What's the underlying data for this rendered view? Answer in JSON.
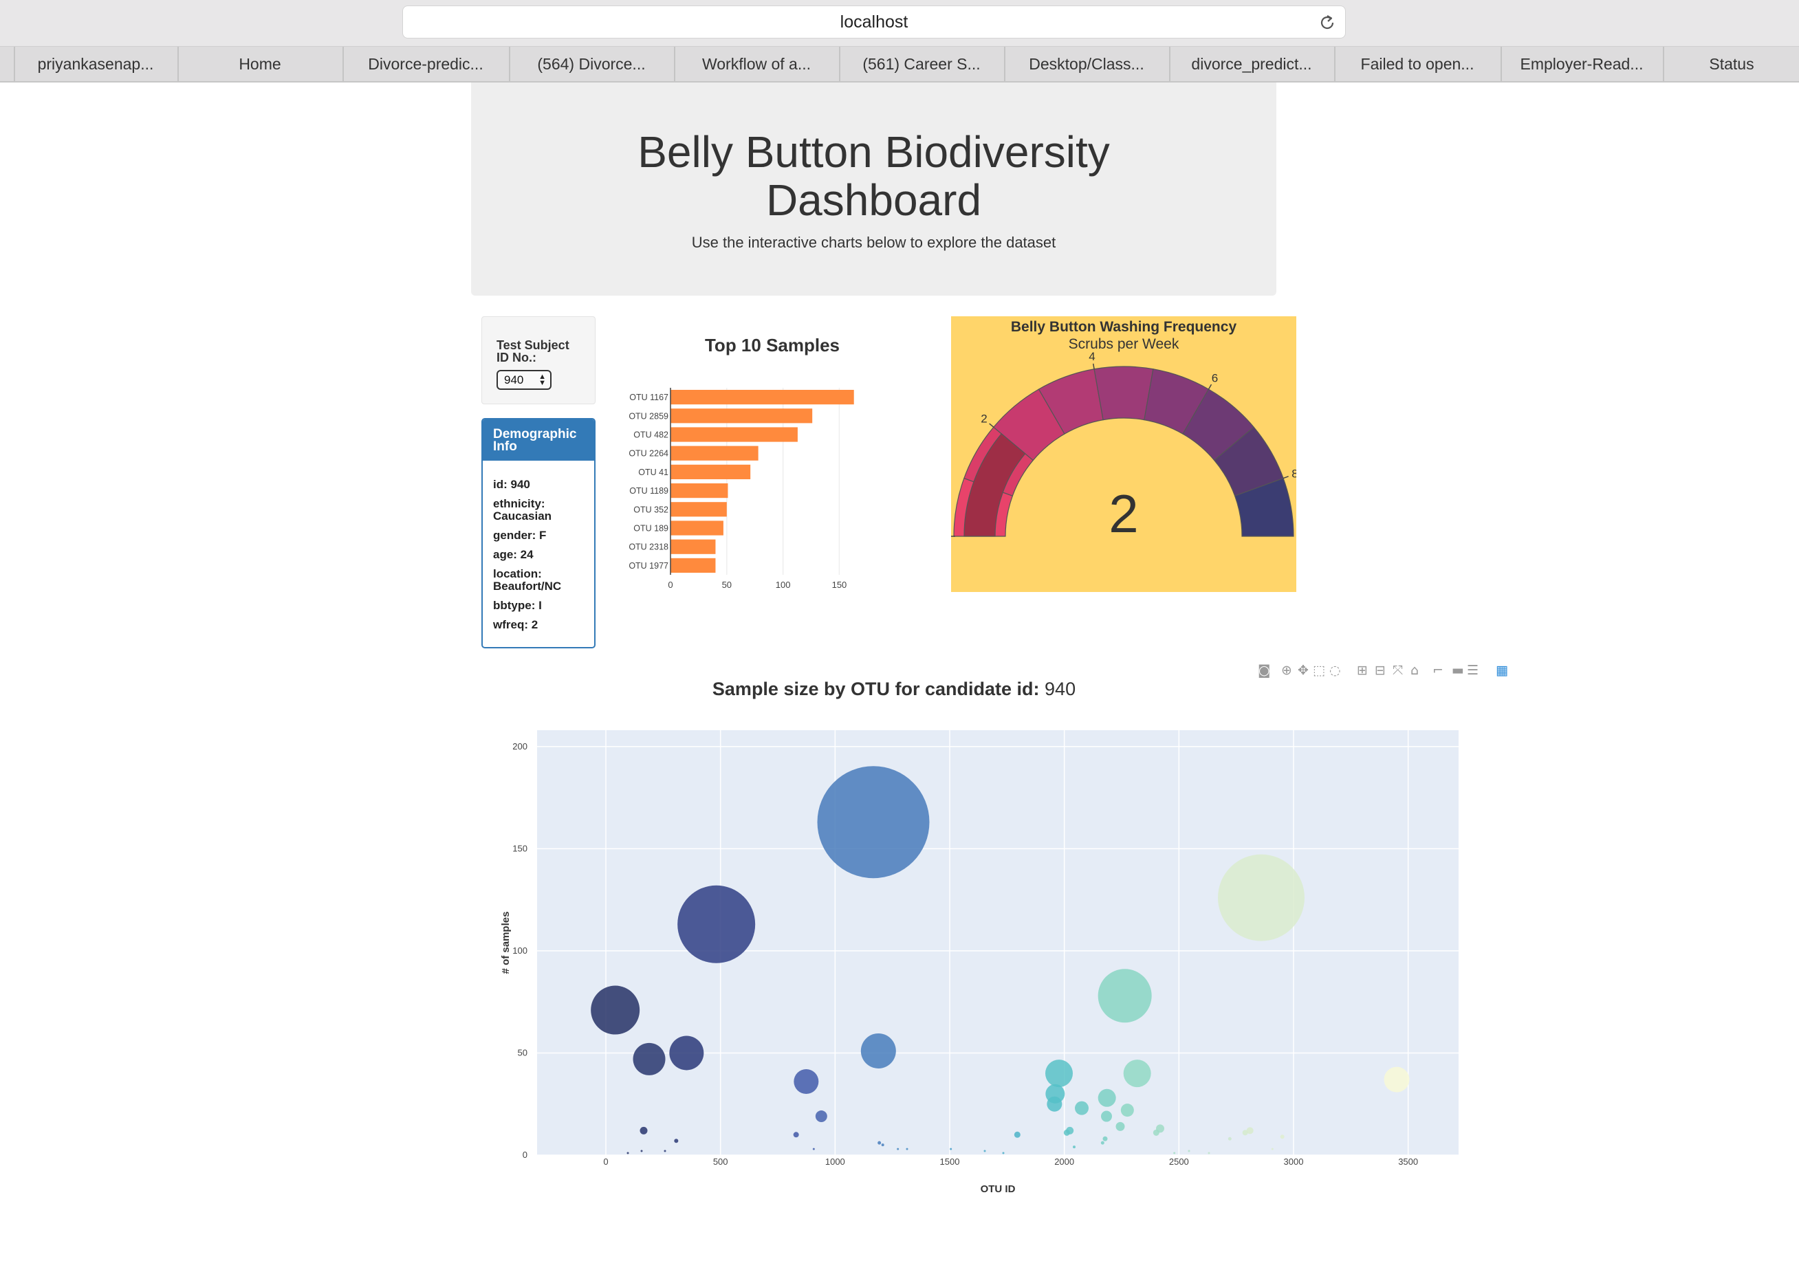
{
  "browser": {
    "url": "localhost",
    "bookmarks": [
      "priyankasenap...",
      "Home",
      "Divorce-predic...",
      "(564) Divorce...",
      "Workflow of a...",
      "(561) Career S...",
      "Desktop/Class...",
      "divorce_predict...",
      "Failed to open...",
      "Employer-Read...",
      "Status"
    ]
  },
  "header": {
    "title_line1": "Belly Button Biodiversity",
    "title_line2": "Dashboard",
    "subtitle": "Use the interactive charts below to explore the dataset"
  },
  "selector": {
    "label_line1": "Test Subject",
    "label_line2": "ID No.:",
    "value": "940"
  },
  "demographics": {
    "heading_line1": "Demographic",
    "heading_line2": "Info",
    "lines": [
      "id: 940",
      "ethnicity:",
      "Caucasian",
      "gender: F",
      "age: 24",
      "location:",
      "Beaufort/NC",
      "bbtype: I",
      "wfreq: 2"
    ]
  },
  "colors": {
    "bar": "#ff8a3d",
    "gauge_background": "#ffd56a",
    "panel_primary": "#337ab7",
    "plot_background": "#e5ecf6"
  },
  "chart_data": [
    {
      "type": "bar",
      "orientation": "horizontal",
      "title": "Top 10 Samples",
      "categories": [
        "OTU 1167",
        "OTU 2859",
        "OTU 482",
        "OTU 2264",
        "OTU 41",
        "OTU 1189",
        "OTU 352",
        "OTU 189",
        "OTU 2318",
        "OTU 1977"
      ],
      "values": [
        163,
        126,
        113,
        78,
        71,
        51,
        50,
        47,
        40,
        40
      ],
      "xlim": [
        0,
        165
      ],
      "xticks": [
        0,
        50,
        100,
        150
      ],
      "color": "#ff8a3d"
    },
    {
      "type": "gauge",
      "title": "Belly Button Washing Frequency",
      "subtitle": "Scrubs per Week",
      "value": 2,
      "range": [
        0,
        9
      ],
      "tick_labels": [
        "2",
        "4",
        "6",
        "8"
      ],
      "tick_values": [
        2,
        4,
        6,
        8
      ],
      "steps": [
        {
          "range": [
            0,
            1
          ],
          "color": "#e8436a"
        },
        {
          "range": [
            1,
            2
          ],
          "color": "#da3d68"
        },
        {
          "range": [
            2,
            3
          ],
          "color": "#c83a6e"
        },
        {
          "range": [
            3,
            4
          ],
          "color": "#b23b74"
        },
        {
          "range": [
            4,
            5
          ],
          "color": "#9c3b77"
        },
        {
          "range": [
            5,
            6
          ],
          "color": "#843a77"
        },
        {
          "range": [
            6,
            7
          ],
          "color": "#6d3a74"
        },
        {
          "range": [
            7,
            8
          ],
          "color": "#573a6e"
        },
        {
          "range": [
            8,
            9
          ],
          "color": "#3b3d72"
        }
      ],
      "bar_color": "#9e2e46"
    },
    {
      "type": "scatter",
      "subtype": "bubble",
      "title_bold": "Sample size by OTU for candidate id:",
      "title_value": "940",
      "xlabel": "OTU ID",
      "ylabel": "# of samples",
      "xlim": [
        -300,
        3720
      ],
      "ylim": [
        0,
        208
      ],
      "xticks": [
        0,
        500,
        1000,
        1500,
        2000,
        2500,
        3000,
        3500
      ],
      "yticks": [
        0,
        50,
        100,
        150,
        200
      ],
      "grid": true,
      "points": [
        {
          "x": 1167,
          "y": 163,
          "size": 163
        },
        {
          "x": 2859,
          "y": 126,
          "size": 126
        },
        {
          "x": 482,
          "y": 113,
          "size": 113
        },
        {
          "x": 2264,
          "y": 78,
          "size": 78
        },
        {
          "x": 41,
          "y": 71,
          "size": 71
        },
        {
          "x": 1189,
          "y": 51,
          "size": 51
        },
        {
          "x": 352,
          "y": 50,
          "size": 50
        },
        {
          "x": 189,
          "y": 47,
          "size": 47
        },
        {
          "x": 2318,
          "y": 40,
          "size": 40
        },
        {
          "x": 1977,
          "y": 40,
          "size": 40
        },
        {
          "x": 3450,
          "y": 37,
          "size": 37
        },
        {
          "x": 874,
          "y": 36,
          "size": 36
        },
        {
          "x": 1960,
          "y": 30,
          "size": 28
        },
        {
          "x": 2186,
          "y": 28,
          "size": 26
        },
        {
          "x": 1957,
          "y": 25,
          "size": 22
        },
        {
          "x": 2076,
          "y": 23,
          "size": 20
        },
        {
          "x": 2275,
          "y": 22,
          "size": 19
        },
        {
          "x": 940,
          "y": 19,
          "size": 17
        },
        {
          "x": 2184,
          "y": 19,
          "size": 16
        },
        {
          "x": 2244,
          "y": 14,
          "size": 13
        },
        {
          "x": 2418,
          "y": 13,
          "size": 12
        },
        {
          "x": 2024,
          "y": 12,
          "size": 11
        },
        {
          "x": 165,
          "y": 12,
          "size": 11
        },
        {
          "x": 2810,
          "y": 12,
          "size": 10
        },
        {
          "x": 2401,
          "y": 11,
          "size": 9
        },
        {
          "x": 2011,
          "y": 11,
          "size": 9
        },
        {
          "x": 1795,
          "y": 10,
          "size": 9
        },
        {
          "x": 2789,
          "y": 11,
          "size": 8
        },
        {
          "x": 830,
          "y": 10,
          "size": 8
        },
        {
          "x": 2178,
          "y": 8,
          "size": 7
        },
        {
          "x": 2951,
          "y": 9,
          "size": 6
        },
        {
          "x": 307,
          "y": 7,
          "size": 6
        },
        {
          "x": 2722,
          "y": 8,
          "size": 5
        },
        {
          "x": 1193,
          "y": 6,
          "size": 5
        },
        {
          "x": 2167,
          "y": 6,
          "size": 5
        },
        {
          "x": 1208,
          "y": 5,
          "size": 4
        },
        {
          "x": 2043,
          "y": 4,
          "size": 4
        },
        {
          "x": 1274,
          "y": 3,
          "size": 3
        },
        {
          "x": 1314,
          "y": 3,
          "size": 3
        },
        {
          "x": 907,
          "y": 3,
          "size": 3
        },
        {
          "x": 1505,
          "y": 3,
          "size": 3
        },
        {
          "x": 2908,
          "y": 3,
          "size": 3
        },
        {
          "x": 258,
          "y": 2,
          "size": 2
        },
        {
          "x": 156,
          "y": 2,
          "size": 2
        },
        {
          "x": 2544,
          "y": 2,
          "size": 2
        },
        {
          "x": 1653,
          "y": 2,
          "size": 2
        },
        {
          "x": 96,
          "y": 1,
          "size": 1
        },
        {
          "x": 2631,
          "y": 1,
          "size": 1
        },
        {
          "x": 1734,
          "y": 1,
          "size": 1
        },
        {
          "x": 2480,
          "y": 1,
          "size": 1
        }
      ],
      "colorscale": "Earth"
    }
  ]
}
